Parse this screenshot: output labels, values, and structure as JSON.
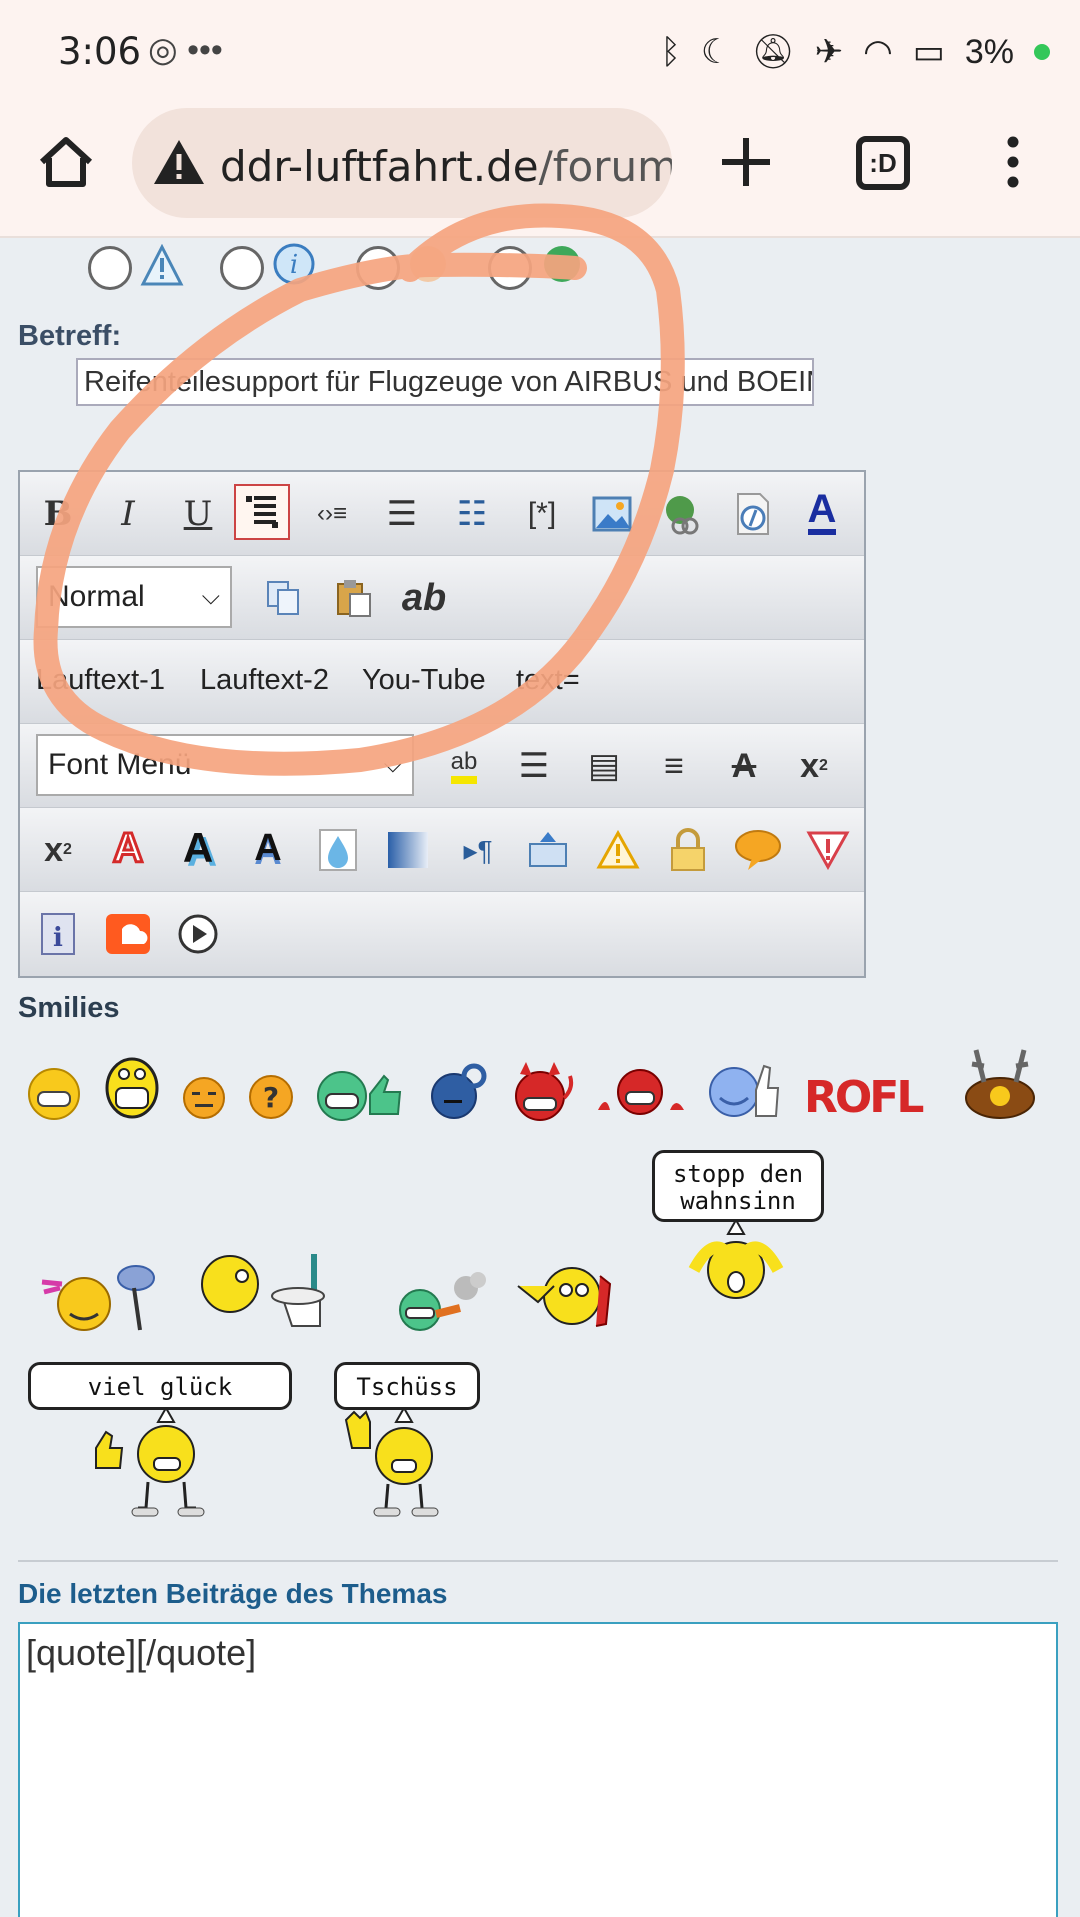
{
  "status_bar": {
    "time": "3:06",
    "overflow": "•••",
    "battery": "3%",
    "icons": [
      "hotspot-icon",
      "bluetooth-icon",
      "moon-icon",
      "mute-icon",
      "airplane-icon",
      "wifi-icon",
      "battery-charging-icon"
    ]
  },
  "browser": {
    "url_domain": "ddr-luftfahrt.de",
    "url_path": "/forum",
    "tabs_label": ":D"
  },
  "form": {
    "betreff_label": "Betreff:",
    "betreff_value": "Reifenteilesupport für Flugzeuge von AIRBUS und BOEIN",
    "font_size_select": "Normal",
    "font_face_select": "Font Menü",
    "text_buttons": [
      "Lauftext-1",
      "Lauftext-2",
      "You-Tube",
      "text="
    ],
    "smilies_label": "Smilies",
    "bubbles": {
      "stopp": "stopp den\nwahnsinn",
      "glueck": "viel glück",
      "tschuess": "Tschüss"
    },
    "rofl": "ROFL",
    "recent_title": "Die letzten Beiträge des Themas",
    "reply_text": "[quote][/quote]"
  },
  "colors": {
    "accent_link": "#1d5d8c",
    "scribble": "#f5a47f",
    "page_bg": "#eaeef2"
  }
}
